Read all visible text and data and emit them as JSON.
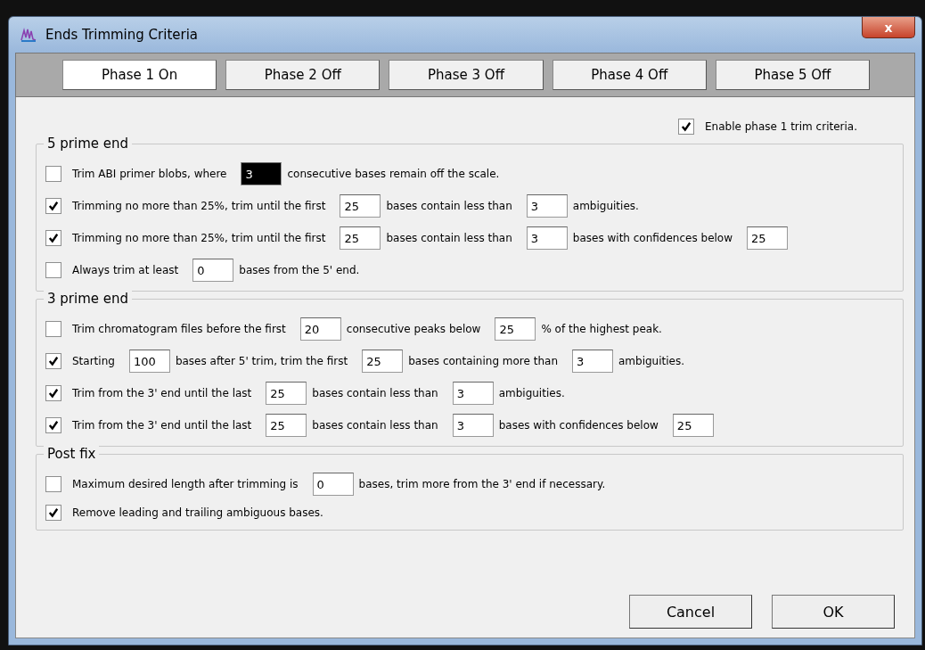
{
  "window": {
    "title": "Ends Trimming Criteria",
    "close": "x"
  },
  "tabs": [
    {
      "label": "Phase 1 On",
      "selected": true
    },
    {
      "label": "Phase 2 Off",
      "selected": false
    },
    {
      "label": "Phase 3 Off",
      "selected": false
    },
    {
      "label": "Phase 4 Off",
      "selected": false
    },
    {
      "label": "Phase 5 Off",
      "selected": false
    }
  ],
  "enable": {
    "label": "Enable phase 1 trim criteria.",
    "checked": true
  },
  "groups": [
    {
      "title": "5 prime end",
      "rows": [
        {
          "checked": false,
          "parts": [
            {
              "kind": "text",
              "text": "Trim ABI primer blobs, where"
            },
            {
              "kind": "field",
              "value": "3",
              "selected": true
            },
            {
              "kind": "text",
              "text": "consecutive bases remain off the scale."
            }
          ]
        },
        {
          "checked": true,
          "parts": [
            {
              "kind": "text",
              "text": "Trimming no more than 25%, trim until the first"
            },
            {
              "kind": "field",
              "value": "25",
              "selected": false
            },
            {
              "kind": "text",
              "text": "bases contain less than"
            },
            {
              "kind": "field",
              "value": "3",
              "selected": false
            },
            {
              "kind": "text",
              "text": "ambiguities."
            }
          ]
        },
        {
          "checked": true,
          "parts": [
            {
              "kind": "text",
              "text": "Trimming no more than 25%, trim until the first"
            },
            {
              "kind": "field",
              "value": "25",
              "selected": false
            },
            {
              "kind": "text",
              "text": "bases contain less than"
            },
            {
              "kind": "field",
              "value": "3",
              "selected": false
            },
            {
              "kind": "text",
              "text": "bases with confidences below"
            },
            {
              "kind": "field",
              "value": "25",
              "selected": false
            }
          ]
        },
        {
          "checked": false,
          "parts": [
            {
              "kind": "text",
              "text": "Always trim at least"
            },
            {
              "kind": "field",
              "value": "0",
              "selected": false
            },
            {
              "kind": "text",
              "text": "bases from the 5' end."
            }
          ]
        }
      ]
    },
    {
      "title": "3 prime end",
      "rows": [
        {
          "checked": false,
          "parts": [
            {
              "kind": "text",
              "text": "Trim chromatogram files before the first"
            },
            {
              "kind": "field",
              "value": "20",
              "selected": false
            },
            {
              "kind": "text",
              "text": "consecutive peaks below"
            },
            {
              "kind": "field",
              "value": "25",
              "selected": false
            },
            {
              "kind": "text",
              "text": "% of the highest peak."
            }
          ]
        },
        {
          "checked": true,
          "parts": [
            {
              "kind": "text",
              "text": "Starting"
            },
            {
              "kind": "field",
              "value": "100",
              "selected": false
            },
            {
              "kind": "text",
              "text": "bases after 5' trim, trim the first"
            },
            {
              "kind": "field",
              "value": "25",
              "selected": false
            },
            {
              "kind": "text",
              "text": "bases containing more than"
            },
            {
              "kind": "field",
              "value": "3",
              "selected": false
            },
            {
              "kind": "text",
              "text": "ambiguities."
            }
          ]
        },
        {
          "checked": true,
          "parts": [
            {
              "kind": "text",
              "text": "Trim from the 3' end until the last"
            },
            {
              "kind": "field",
              "value": "25",
              "selected": false
            },
            {
              "kind": "text",
              "text": "bases contain less than"
            },
            {
              "kind": "field",
              "value": "3",
              "selected": false
            },
            {
              "kind": "text",
              "text": "ambiguities."
            }
          ]
        },
        {
          "checked": true,
          "parts": [
            {
              "kind": "text",
              "text": "Trim from the 3' end until the last"
            },
            {
              "kind": "field",
              "value": "25",
              "selected": false
            },
            {
              "kind": "text",
              "text": "bases contain less than"
            },
            {
              "kind": "field",
              "value": "3",
              "selected": false
            },
            {
              "kind": "text",
              "text": "bases with confidences below"
            },
            {
              "kind": "field",
              "value": "25",
              "selected": false
            }
          ]
        }
      ]
    },
    {
      "title": "Post fix",
      "rows": [
        {
          "checked": false,
          "parts": [
            {
              "kind": "text",
              "text": "Maximum desired length after trimming is"
            },
            {
              "kind": "field",
              "value": "0",
              "selected": false
            },
            {
              "kind": "text",
              "text": "bases, trim more from the 3' end if necessary."
            }
          ]
        },
        {
          "checked": true,
          "parts": [
            {
              "kind": "text",
              "text": "Remove leading and trailing ambiguous bases."
            }
          ]
        }
      ]
    }
  ],
  "buttons": [
    "Cancel",
    "OK"
  ]
}
